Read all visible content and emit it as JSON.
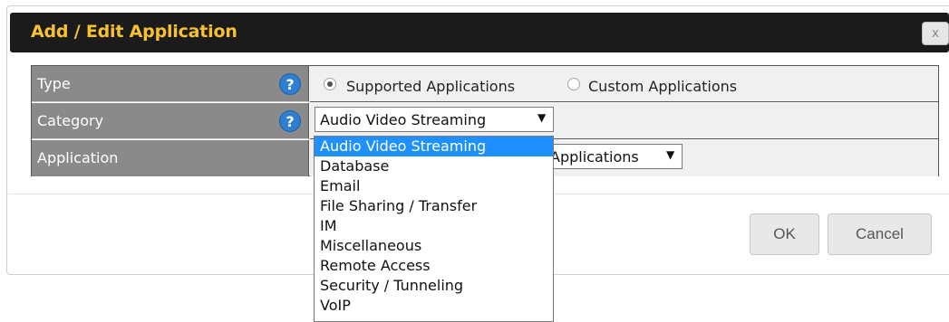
{
  "dialog": {
    "title": "Add / Edit Application",
    "close_label": "x"
  },
  "form": {
    "type": {
      "label": "Type",
      "help": "?",
      "options": [
        "Supported Applications",
        "Custom Applications"
      ],
      "selected": "Supported Applications"
    },
    "category": {
      "label": "Category",
      "help": "?",
      "value": "Audio Video Streaming",
      "arrow": "▼"
    },
    "application": {
      "label": "Application",
      "value": "Applications",
      "arrow": "▼"
    }
  },
  "category_dropdown": {
    "items": [
      "Audio Video Streaming",
      "Database",
      "Email",
      "File Sharing / Transfer",
      "IM",
      "Miscellaneous",
      "Remote Access",
      "Security / Tunneling",
      "VoIP"
    ],
    "highlighted": "Audio Video Streaming"
  },
  "buttons": {
    "ok": "OK",
    "cancel": "Cancel"
  },
  "colors": {
    "title_text": "#f7c12f",
    "title_bar": "#1b1b1b",
    "label_cell": "#8a8a8a",
    "help_icon": "#2f7fd1",
    "highlight": "#1e90ff"
  }
}
